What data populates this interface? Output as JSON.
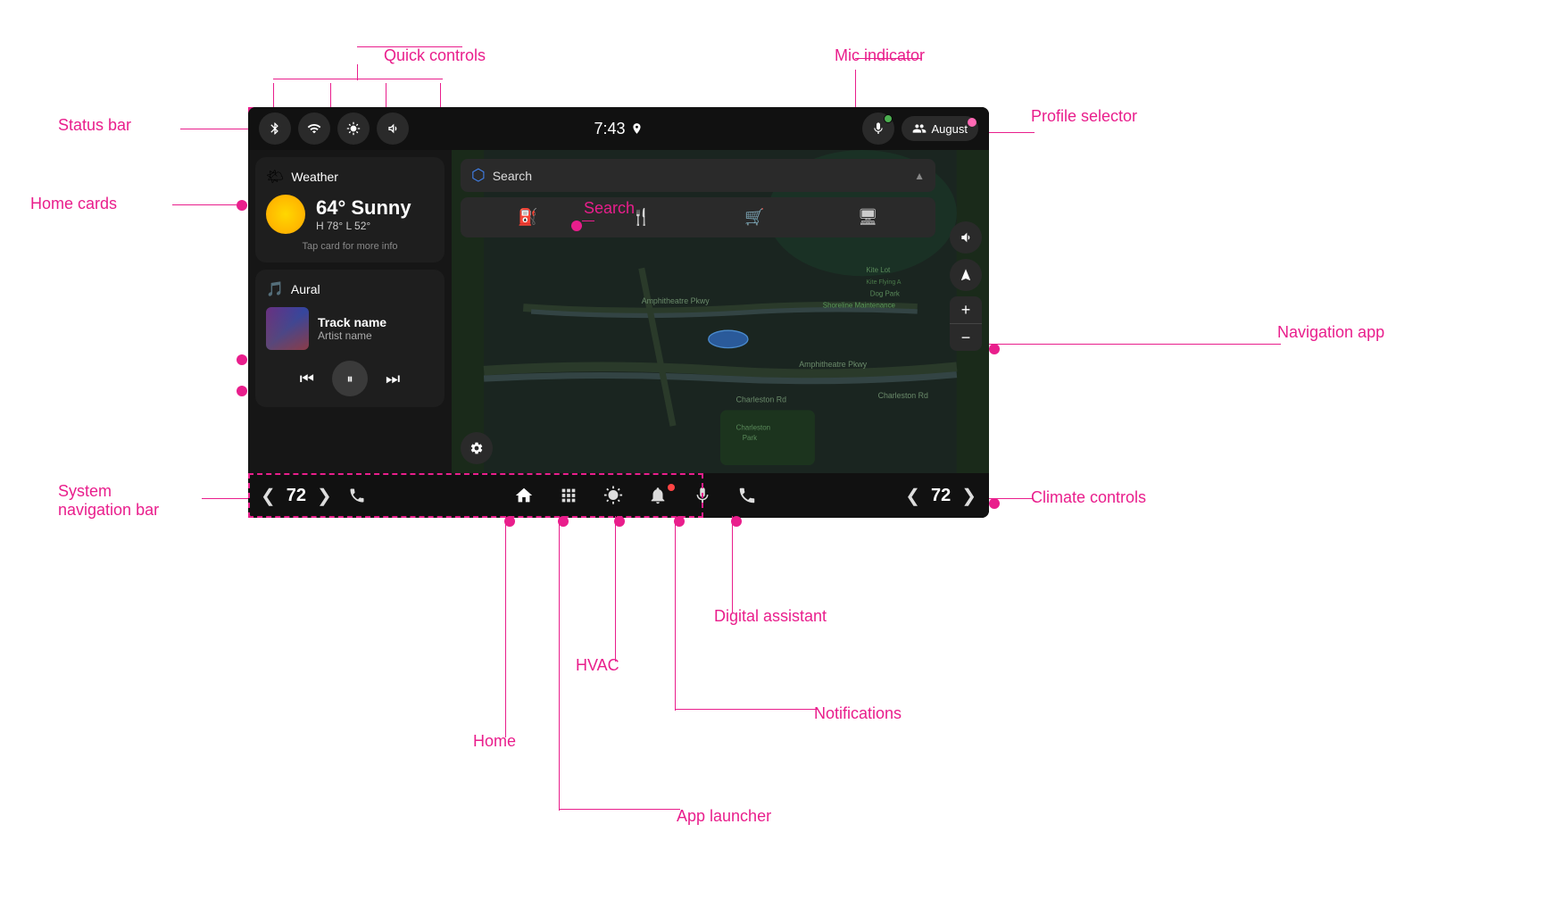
{
  "screen": {
    "time": "7:43",
    "profile": "August"
  },
  "status_bar": {
    "label": "Status bar",
    "icons": [
      "bluetooth",
      "signal",
      "brightness",
      "volume"
    ]
  },
  "home_cards": {
    "label": "Home cards",
    "weather": {
      "title": "Weather",
      "temp": "64° Sunny",
      "highlow": "H 78° L 52°",
      "tap_hint": "Tap card for more info"
    },
    "music": {
      "app_name": "Aural",
      "track_name": "Track name",
      "artist_name": "Artist name"
    }
  },
  "search": {
    "label": "Search",
    "placeholder": "Search",
    "poi_icons": [
      "fuel",
      "restaurant",
      "shopping",
      "screen"
    ]
  },
  "navigation_app": {
    "label": "Navigation app"
  },
  "mic_indicator": {
    "label": "Mic indicator"
  },
  "profile_selector": {
    "label": "Profile selector"
  },
  "quick_controls": {
    "label": "Quick controls"
  },
  "system_navigation_bar": {
    "label": "System navigation bar",
    "temp": "72"
  },
  "climate_controls": {
    "label": "Climate controls",
    "temp": "72"
  },
  "home": {
    "label": "Home"
  },
  "app_launcher": {
    "label": "App launcher"
  },
  "hvac": {
    "label": "HVAC"
  },
  "notifications": {
    "label": "Notifications"
  },
  "digital_assistant": {
    "label": "Digital assistant"
  },
  "map": {
    "roads": [
      "Amphitheatre Pkwy",
      "Charleston Rd",
      "Shoreline Maintenance"
    ],
    "parks": [
      "Charleston Park",
      "Kite Lot",
      "Dog Park",
      "Kite Flying A"
    ]
  }
}
